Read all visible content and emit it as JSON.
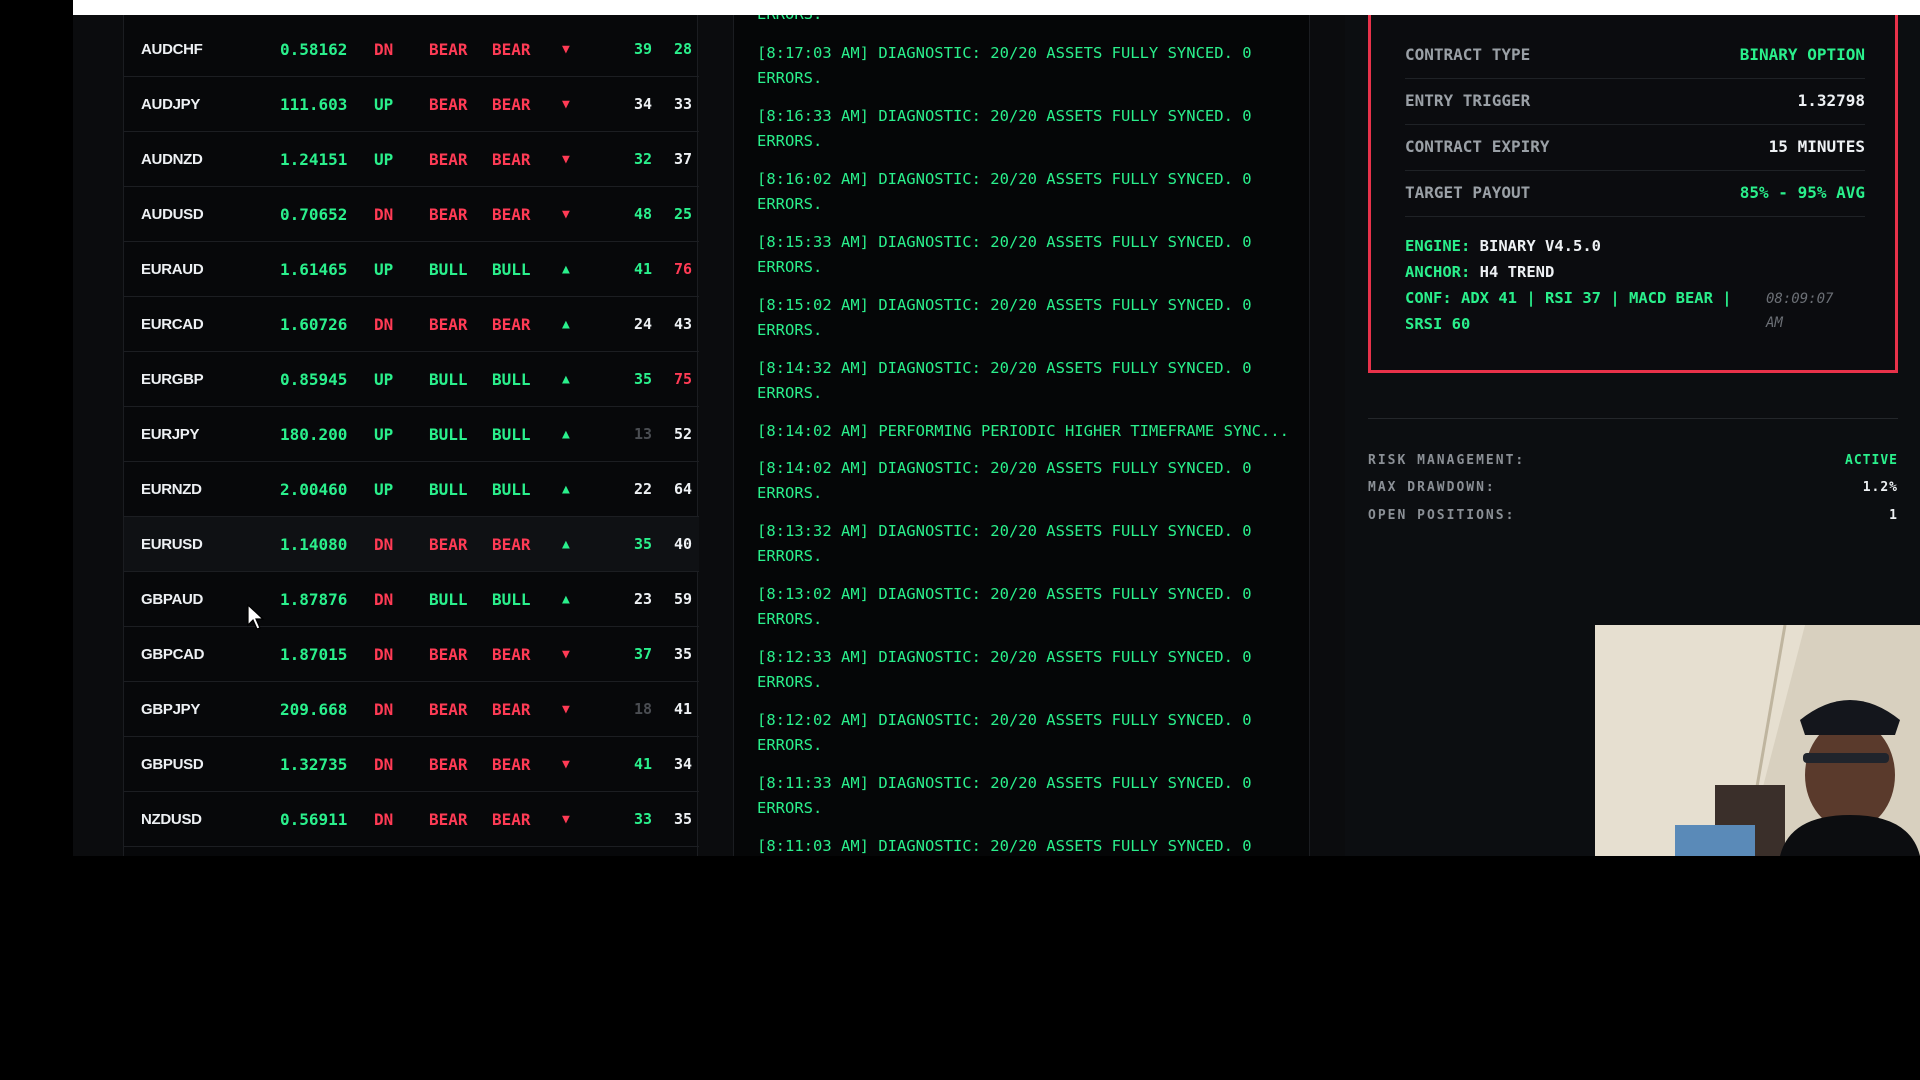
{
  "scanner": {
    "rows": [
      {
        "pair": "AUDCHF",
        "price": "0.58162",
        "dir": "DN",
        "dir_color": "dn",
        "bias1": "BEAR",
        "bias1_color": "dn",
        "bias2": "BEAR",
        "bias2_color": "dn",
        "arrow": "▼",
        "arrow_color": "dn",
        "n1": "39",
        "n1_color": "up",
        "n2": "28",
        "n2_color": "up"
      },
      {
        "pair": "AUDJPY",
        "price": "111.603",
        "dir": "UP",
        "dir_color": "up",
        "bias1": "BEAR",
        "bias1_color": "dn",
        "bias2": "BEAR",
        "bias2_color": "dn",
        "arrow": "▼",
        "arrow_color": "dn",
        "n1": "34",
        "n1_color": "white",
        "n2": "33",
        "n2_color": "white"
      },
      {
        "pair": "AUDNZD",
        "price": "1.24151",
        "dir": "UP",
        "dir_color": "up",
        "bias1": "BEAR",
        "bias1_color": "dn",
        "bias2": "BEAR",
        "bias2_color": "dn",
        "arrow": "▼",
        "arrow_color": "dn",
        "n1": "32",
        "n1_color": "up",
        "n2": "37",
        "n2_color": "white"
      },
      {
        "pair": "AUDUSD",
        "price": "0.70652",
        "dir": "DN",
        "dir_color": "dn",
        "bias1": "BEAR",
        "bias1_color": "dn",
        "bias2": "BEAR",
        "bias2_color": "dn",
        "arrow": "▼",
        "arrow_color": "dn",
        "n1": "48",
        "n1_color": "up",
        "n2": "25",
        "n2_color": "up"
      },
      {
        "pair": "EURAUD",
        "price": "1.61465",
        "dir": "UP",
        "dir_color": "up",
        "bias1": "BULL",
        "bias1_color": "up",
        "bias2": "BULL",
        "bias2_color": "up",
        "arrow": "▲",
        "arrow_color": "up",
        "n1": "41",
        "n1_color": "up",
        "n2": "76",
        "n2_color": "dn"
      },
      {
        "pair": "EURCAD",
        "price": "1.60726",
        "dir": "DN",
        "dir_color": "dn",
        "bias1": "BEAR",
        "bias1_color": "dn",
        "bias2": "BEAR",
        "bias2_color": "dn",
        "arrow": "▲",
        "arrow_color": "up",
        "n1": "24",
        "n1_color": "white",
        "n2": "43",
        "n2_color": "white"
      },
      {
        "pair": "EURGBP",
        "price": "0.85945",
        "dir": "UP",
        "dir_color": "up",
        "bias1": "BULL",
        "bias1_color": "up",
        "bias2": "BULL",
        "bias2_color": "up",
        "arrow": "▲",
        "arrow_color": "up",
        "n1": "35",
        "n1_color": "up",
        "n2": "75",
        "n2_color": "dn"
      },
      {
        "pair": "EURJPY",
        "price": "180.200",
        "dir": "UP",
        "dir_color": "up",
        "bias1": "BULL",
        "bias1_color": "up",
        "bias2": "BULL",
        "bias2_color": "up",
        "arrow": "▲",
        "arrow_color": "up",
        "n1": "13",
        "n1_color": "dim",
        "n2": "52",
        "n2_color": "white"
      },
      {
        "pair": "EURNZD",
        "price": "2.00460",
        "dir": "UP",
        "dir_color": "up",
        "bias1": "BULL",
        "bias1_color": "up",
        "bias2": "BULL",
        "bias2_color": "up",
        "arrow": "▲",
        "arrow_color": "up",
        "n1": "22",
        "n1_color": "white",
        "n2": "64",
        "n2_color": "white"
      },
      {
        "pair": "EURUSD",
        "price": "1.14080",
        "dir": "DN",
        "dir_color": "dn",
        "bias1": "BEAR",
        "bias1_color": "dn",
        "bias2": "BEAR",
        "bias2_color": "dn",
        "arrow": "▲",
        "arrow_color": "up",
        "n1": "35",
        "n1_color": "up",
        "n2": "40",
        "n2_color": "white"
      },
      {
        "pair": "GBPAUD",
        "price": "1.87876",
        "dir": "DN",
        "dir_color": "dn",
        "bias1": "BULL",
        "bias1_color": "up",
        "bias2": "BULL",
        "bias2_color": "up",
        "arrow": "▲",
        "arrow_color": "up",
        "n1": "23",
        "n1_color": "white",
        "n2": "59",
        "n2_color": "white"
      },
      {
        "pair": "GBPCAD",
        "price": "1.87015",
        "dir": "DN",
        "dir_color": "dn",
        "bias1": "BEAR",
        "bias1_color": "dn",
        "bias2": "BEAR",
        "bias2_color": "dn",
        "arrow": "▼",
        "arrow_color": "dn",
        "n1": "37",
        "n1_color": "up",
        "n2": "35",
        "n2_color": "white"
      },
      {
        "pair": "GBPJPY",
        "price": "209.668",
        "dir": "DN",
        "dir_color": "dn",
        "bias1": "BEAR",
        "bias1_color": "dn",
        "bias2": "BEAR",
        "bias2_color": "dn",
        "arrow": "▼",
        "arrow_color": "dn",
        "n1": "18",
        "n1_color": "dim",
        "n2": "41",
        "n2_color": "white"
      },
      {
        "pair": "GBPUSD",
        "price": "1.32735",
        "dir": "DN",
        "dir_color": "dn",
        "bias1": "BEAR",
        "bias1_color": "dn",
        "bias2": "BEAR",
        "bias2_color": "dn",
        "arrow": "▼",
        "arrow_color": "dn",
        "n1": "41",
        "n1_color": "up",
        "n2": "34",
        "n2_color": "white"
      },
      {
        "pair": "NZDUSD",
        "price": "0.56911",
        "dir": "DN",
        "dir_color": "dn",
        "bias1": "BEAR",
        "bias1_color": "dn",
        "bias2": "BEAR",
        "bias2_color": "dn",
        "arrow": "▼",
        "arrow_color": "dn",
        "n1": "33",
        "n1_color": "up",
        "n2": "35",
        "n2_color": "white"
      }
    ]
  },
  "log": {
    "clipped_top": "ERRORS.",
    "entries": [
      {
        "l1": "[8:17:03 AM] DIAGNOSTIC: 20/20 ASSETS FULLY SYNCED. 0",
        "l2": "ERRORS."
      },
      {
        "l1": "[8:16:33 AM] DIAGNOSTIC: 20/20 ASSETS FULLY SYNCED. 0",
        "l2": "ERRORS."
      },
      {
        "l1": "[8:16:02 AM] DIAGNOSTIC: 20/20 ASSETS FULLY SYNCED. 0",
        "l2": "ERRORS."
      },
      {
        "l1": "[8:15:33 AM] DIAGNOSTIC: 20/20 ASSETS FULLY SYNCED. 0",
        "l2": "ERRORS."
      },
      {
        "l1": "[8:15:02 AM] DIAGNOSTIC: 20/20 ASSETS FULLY SYNCED. 0",
        "l2": "ERRORS."
      },
      {
        "l1": "[8:14:32 AM] DIAGNOSTIC: 20/20 ASSETS FULLY SYNCED. 0",
        "l2": "ERRORS."
      },
      {
        "l1": "[8:14:02 AM] PERFORMING PERIODIC HIGHER TIMEFRAME SYNC...",
        "l2": ""
      },
      {
        "l1": "[8:14:02 AM] DIAGNOSTIC: 20/20 ASSETS FULLY SYNCED. 0",
        "l2": "ERRORS."
      },
      {
        "l1": "[8:13:32 AM] DIAGNOSTIC: 20/20 ASSETS FULLY SYNCED. 0",
        "l2": "ERRORS."
      },
      {
        "l1": "[8:13:02 AM] DIAGNOSTIC: 20/20 ASSETS FULLY SYNCED. 0",
        "l2": "ERRORS."
      },
      {
        "l1": "[8:12:33 AM] DIAGNOSTIC: 20/20 ASSETS FULLY SYNCED. 0",
        "l2": "ERRORS."
      },
      {
        "l1": "[8:12:02 AM] DIAGNOSTIC: 20/20 ASSETS FULLY SYNCED. 0",
        "l2": "ERRORS."
      },
      {
        "l1": "[8:11:33 AM] DIAGNOSTIC: 20/20 ASSETS FULLY SYNCED. 0",
        "l2": "ERRORS."
      },
      {
        "l1": "[8:11:03 AM] DIAGNOSTIC: 20/20 ASSETS FULLY SYNCED. 0",
        "l2": ""
      }
    ]
  },
  "contract": {
    "type_label": "CONTRACT TYPE",
    "type_value": "BINARY OPTION",
    "entry_label": "ENTRY TRIGGER",
    "entry_value": "1.32798",
    "expiry_label": "CONTRACT EXPIRY",
    "expiry_value": "15 MINUTES",
    "payout_label": "TARGET PAYOUT",
    "payout_value": "85% - 95% AVG",
    "engine_label": "ENGINE:",
    "engine_value": "BINARY V4.5.0",
    "anchor_label": "ANCHOR:",
    "anchor_value": "H4 TREND",
    "conf_label": "CONF:",
    "conf_value": "ADX 41 | RSI 37 | MACD BEAR |",
    "conf_value2": "SRSI 60",
    "timestamp_l1": "08:09:07",
    "timestamp_l2": "AM"
  },
  "risk": {
    "mgmt_label": "RISK MANAGEMENT:",
    "mgmt_value": "ACTIVE",
    "drawdown_label": "MAX DRAWDOWN:",
    "drawdown_value": "1.2%",
    "positions_label": "OPEN POSITIONS:",
    "positions_value": "1"
  },
  "colors": {
    "up": "#2af08c",
    "dn": "#ff3b55",
    "white": "#eef1f4",
    "dim": "#4a4d52",
    "accent_border": "#e8324a"
  },
  "icons": {
    "cursor": "arrow-cursor-icon"
  }
}
